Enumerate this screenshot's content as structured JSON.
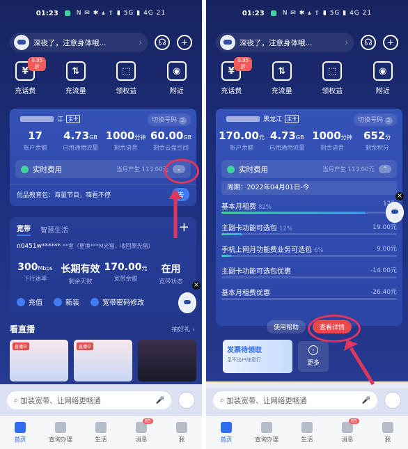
{
  "status": {
    "time": "01:23",
    "icons": "N ✉ ✱ ▴ ⇧ ▮ 5G ▮ 4G 21"
  },
  "header": {
    "greeting": "深夜了，注意身体哦...",
    "chevron": "›",
    "headset_icon": "headset-icon",
    "add_icon": "+"
  },
  "quick": [
    {
      "label": "充话费",
      "icon": "¥",
      "badge": "0.95折"
    },
    {
      "label": "充流量",
      "icon": "⇅"
    },
    {
      "label": "领权益",
      "icon": "⬚"
    },
    {
      "label": "附近",
      "icon": "◉"
    }
  ],
  "left": {
    "account": {
      "region": "江",
      "tag": "主卡",
      "switch_label": "切换号码",
      "switch_count": "2"
    },
    "metrics": [
      {
        "value": "17",
        "unit": "",
        "label": "账户余额"
      },
      {
        "value": "4.73",
        "unit": "GB",
        "label": "已用通用流量"
      },
      {
        "value": "1000",
        "unit": "分钟",
        "label": "剩余语音"
      },
      {
        "value": "60.00",
        "unit": "GB",
        "label": "剩余云盘空间"
      }
    ],
    "fee": {
      "label": "实时费用",
      "generated": "当月产生 113.00元",
      "toggle": "⌄"
    },
    "promo": {
      "text": "优品教育包：海量节目，嗨看不停",
      "button": "去"
    },
    "broadband": {
      "tab_on": "宽带",
      "tab_off": "智慧生活",
      "plus": "+",
      "account": "n0451w******",
      "account_note": "**室（更换***M光猫，收回原光猫）",
      "metrics": [
        {
          "value": "300",
          "unit": "Mbps",
          "label": "下行速率"
        },
        {
          "value": "长期有效",
          "unit": "",
          "label": "剩余天数"
        },
        {
          "value": "170.00",
          "unit": "元",
          "label": "宽带余额"
        },
        {
          "value": "在用",
          "unit": "",
          "label": "宽带状态"
        }
      ],
      "actions": [
        "充值",
        "新装",
        "宽带密码修改"
      ]
    },
    "live": {
      "title": "看直播",
      "more": "抽好礼 ›",
      "tag": "直播中"
    }
  },
  "right": {
    "account": {
      "region": "黑龙江",
      "tag": "主卡",
      "switch_label": "切换号码",
      "switch_count": "2"
    },
    "metrics": [
      {
        "value": "170.00",
        "unit": "元",
        "label": "账户余额"
      },
      {
        "value": "4.73",
        "unit": "GB",
        "label": "已用通用流量"
      },
      {
        "value": "1000",
        "unit": "分钟",
        "label": "剩余语音"
      },
      {
        "value": "652",
        "unit": "分",
        "label": "剩余积分"
      }
    ],
    "fee": {
      "label": "实时费用",
      "generated": "当月产生 113.00元",
      "toggle": "⌃"
    },
    "period": "周期：2022年04月01日-今",
    "items": [
      {
        "name": "基本月租费",
        "pct": "82%",
        "amount": "125.",
        "fill": 0.82
      },
      {
        "name": "主副卡功能可选包",
        "pct": "12%",
        "amount": "19.00元",
        "fill": 0.12
      },
      {
        "name": "手机上网月功能费业务可选包",
        "pct": "6%",
        "amount": "9.00元",
        "fill": 0.06
      },
      {
        "name": "主副卡功能可选包优惠",
        "pct": "",
        "amount": "-14.00元",
        "fill": 0
      },
      {
        "name": "基本月租费优惠",
        "pct": "",
        "amount": "-26.40元",
        "fill": 0
      }
    ],
    "buttons": {
      "help": "使用帮助",
      "detail": "查看详情"
    },
    "banner": {
      "title": "发票待领取",
      "sub": "足不出户随意打"
    },
    "more": "更多"
  },
  "search": {
    "placeholder": "加装宽带、让网络更畅通",
    "mic": "🎤"
  },
  "tabbar": [
    {
      "label": "首页",
      "active": true
    },
    {
      "label": "查询办理"
    },
    {
      "label": "生活"
    },
    {
      "label": "消息",
      "badge": "65"
    },
    {
      "label": "我"
    }
  ],
  "colors": {
    "highlight": "#e0365d",
    "accent": "#2f6cf0",
    "green": "#3fd29b"
  }
}
